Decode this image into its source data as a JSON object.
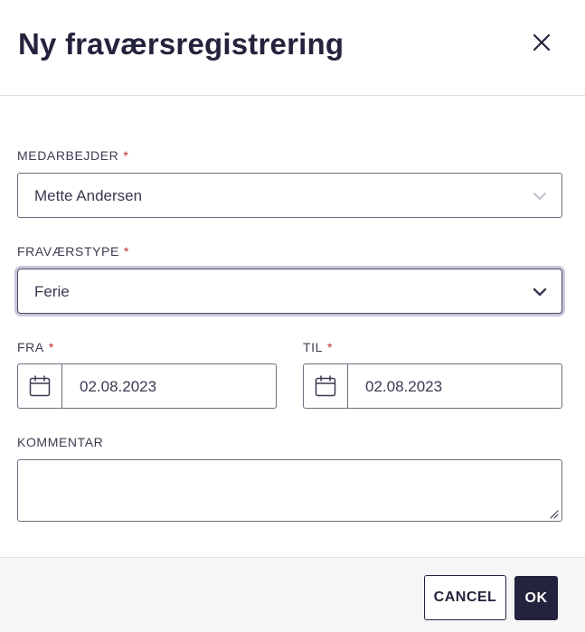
{
  "dialog": {
    "title": "Ny fraværsregistrering",
    "close_icon": "close-icon"
  },
  "form": {
    "required_marker": "*",
    "employee": {
      "label": "MEDARBEJDER",
      "value": "Mette Andersen",
      "icon": "chevron-down-icon"
    },
    "absence_type": {
      "label": "FRAVÆRSTYPE",
      "value": "Ferie",
      "icon": "chevron-down-icon"
    },
    "from": {
      "label": "FRA",
      "value": "02.08.2023",
      "icon": "calendar-icon"
    },
    "to": {
      "label": "TIL",
      "value": "02.08.2023",
      "icon": "calendar-icon"
    },
    "comment": {
      "label": "KOMMENTAR",
      "value": ""
    }
  },
  "footer": {
    "cancel_label": "CANCEL",
    "ok_label": "OK"
  },
  "colors": {
    "primary": "#24233d",
    "required": "#c1272d",
    "focus_ring": "#c8c7db",
    "footer_bg": "#f6f6f7"
  }
}
